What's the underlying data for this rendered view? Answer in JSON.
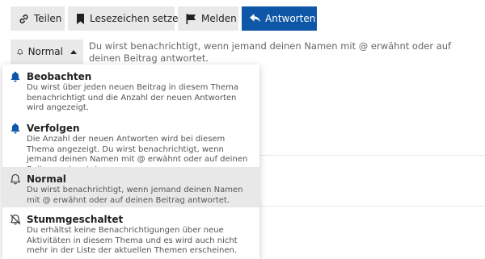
{
  "toolbar": {
    "share_label": "Teilen",
    "bookmark_label": "Lesezeichen setzen",
    "flag_label": "Melden",
    "reply_label": "Antworten",
    "accent_color": "#0e57a8",
    "button_bg": "#e9e9e9"
  },
  "notifications": {
    "current_level": "Normal",
    "current_description": "Du wirst benachrichtigt, wenn jemand deinen Namen mit @ erwähnt oder auf deinen Beitrag antwortet.",
    "options": [
      {
        "title": "Beobachten",
        "description": "Du wirst über jeden neuen Beitrag in diesem Thema benachrichtigt und die Anzahl der neuen Antworten wird angezeigt.",
        "icon": "bell-filled-icon"
      },
      {
        "title": "Verfolgen",
        "description": "Die Anzahl der neuen Antworten wird bei diesem Thema angezeigt. Du wirst benachrichtigt, wenn jemand deinen Namen mit @ erwähnt oder auf deinen Beitrag antwortet.",
        "icon": "bell-filled-icon"
      },
      {
        "title": "Normal",
        "description": "Du wirst benachrichtigt, wenn jemand deinen Namen mit @ erwähnt oder auf deinen Beitrag antwortet.",
        "icon": "bell-outline-icon",
        "selected": true
      },
      {
        "title": "Stummgeschaltet",
        "description": "Du erhältst keine Benachrichtigungen über neue Aktivitäten in diesem Thema und es wird auch nicht mehr in der Liste der aktuellen Themen erscheinen.",
        "icon": "bell-slash-icon"
      }
    ],
    "watch_icon_color": "#0e57a8",
    "highlight_color": "#e8e8e8"
  }
}
